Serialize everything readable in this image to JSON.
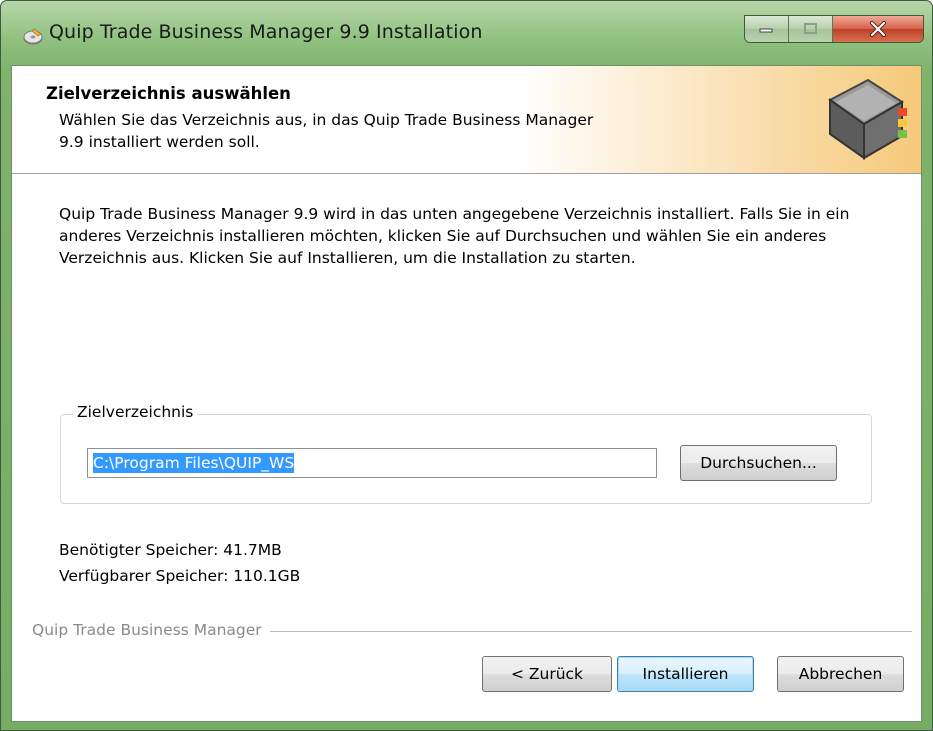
{
  "window": {
    "title": "Quip Trade Business Manager 9.9 Installation"
  },
  "header": {
    "title": "Zielverzeichnis auswählen",
    "subtitle": "Wählen Sie das Verzeichnis aus, in das Quip Trade Business Manager 9.9 installiert werden soll."
  },
  "body": {
    "intro": "Quip Trade Business Manager 9.9 wird in das unten angegebene Verzeichnis installiert. Falls Sie in ein anderes Verzeichnis installieren möchten, klicken Sie auf Durchsuchen und wählen Sie ein anderes Verzeichnis aus. Klicken Sie auf Installieren, um die Installation zu starten.",
    "group_label": "Zielverzeichnis",
    "path_value": "C:\\Program Files\\QUIP_WS",
    "browse_label": "Durchsuchen...",
    "space_required": "Benötigter Speicher: 41.7MB",
    "space_available": "Verfügbarer Speicher: 110.1GB"
  },
  "footer": {
    "brand": "Quip Trade Business Manager",
    "back_label": "< Zurück",
    "install_label": "Installieren",
    "cancel_label": "Abbrechen"
  },
  "icons": {
    "title": "installer-disk-icon",
    "header": "book-icon",
    "minimize": "minimize-icon",
    "maximize": "maximize-icon",
    "close": "close-icon"
  },
  "colors": {
    "frame": "#8fc07e",
    "selection": "#3399ff",
    "close_button": "#c0402a",
    "header_accent": "#f6c97a"
  }
}
